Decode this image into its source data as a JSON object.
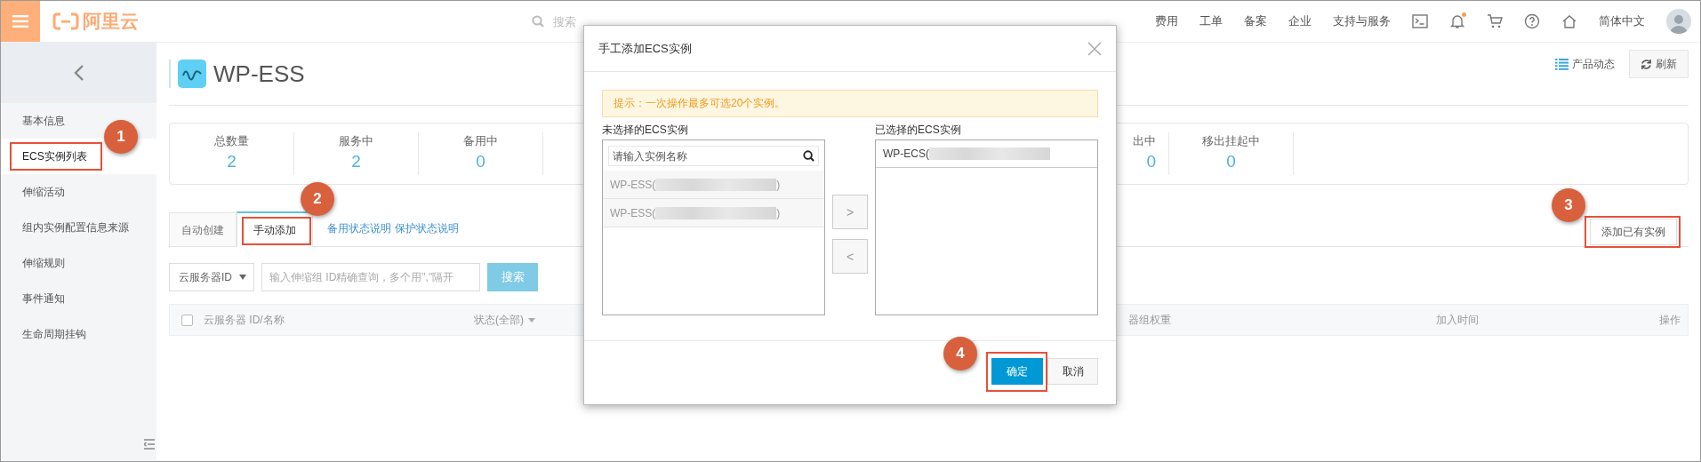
{
  "topbar": {
    "logo_text": "阿里云",
    "search_placeholder": "搜索",
    "nav": [
      "费用",
      "工单",
      "备案",
      "企业",
      "支持与服务"
    ],
    "bell_unread": true,
    "language": "简体中文"
  },
  "sidebar": {
    "items": [
      {
        "label": "基本信息",
        "selected": false,
        "highlighted": false
      },
      {
        "label": "ECS实例列表",
        "selected": true,
        "highlighted": true,
        "callout": "1"
      },
      {
        "label": "伸缩活动",
        "selected": false,
        "highlighted": false
      },
      {
        "label": "组内实例配置信息来源",
        "selected": false,
        "highlighted": false
      },
      {
        "label": "伸缩规则",
        "selected": false,
        "highlighted": false
      },
      {
        "label": "事件通知",
        "selected": false,
        "highlighted": false
      },
      {
        "label": "生命周期挂钩",
        "selected": false,
        "highlighted": false
      }
    ]
  },
  "page": {
    "title": "WP-ESS",
    "news_link": "产品动态",
    "refresh_button": "刷新"
  },
  "stats": [
    {
      "label": "总数量",
      "value": "2"
    },
    {
      "label": "服务中",
      "value": "2"
    },
    {
      "label": "备用中",
      "value": "0"
    },
    {
      "label": "出中",
      "value": "0"
    },
    {
      "label": "移出挂起中",
      "value": "0"
    }
  ],
  "tabs": [
    {
      "label": "自动创建",
      "selected": false,
      "highlighted": false
    },
    {
      "label": "手动添加",
      "selected": true,
      "highlighted": true,
      "callout": "2"
    }
  ],
  "help_links": [
    "备用状态说明",
    "保护状态说明"
  ],
  "add_button": {
    "label": "添加已有实例",
    "highlighted": true,
    "callout": "3"
  },
  "filter": {
    "select": "云服务器ID",
    "placeholder": "输入伸缩组 ID精确查询，多个用\",\"隔开",
    "search_button": "搜索"
  },
  "table": {
    "select_all_checked": false,
    "columns": [
      {
        "label": "云服务器 ID/名称",
        "kind": "plain"
      },
      {
        "label": "状态(全部)",
        "kind": "dropdown"
      },
      {
        "label": "器组权重",
        "kind": "plain"
      },
      {
        "label": "加入时间",
        "kind": "plain"
      },
      {
        "label": "操作",
        "kind": "plain"
      }
    ]
  },
  "dialog": {
    "title": "手工添加ECS实例",
    "tip": "提示：一次操作最多可选20个实例。",
    "available_label": "未选择的ECS实例",
    "search_placeholder": "请输入实例名称",
    "available": [
      {
        "prefix": "WP-ESS(",
        "suffix": ")"
      },
      {
        "prefix": "WP-ESS(",
        "suffix": ")"
      }
    ],
    "move_right": ">",
    "move_left": "<",
    "selected_label": "已选择的ECS实例",
    "selected_items": [
      {
        "prefix": "WP-ECS("
      }
    ],
    "ok_button": {
      "label": "确定",
      "highlighted": true,
      "callout": "4"
    },
    "cancel_button": "取消"
  }
}
